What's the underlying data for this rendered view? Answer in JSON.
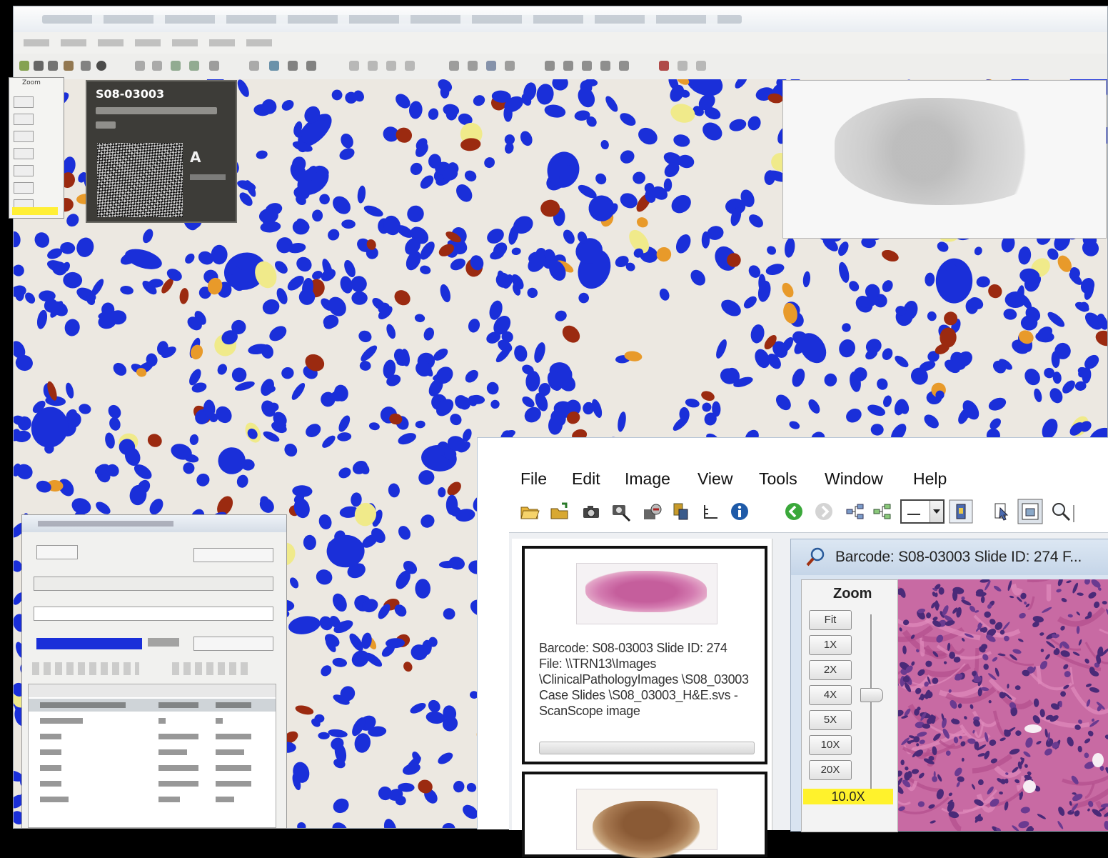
{
  "background_window": {
    "label_barcode": "S08-03003",
    "label_letter": "A"
  },
  "menu": {
    "items": [
      "File",
      "Edit",
      "Image",
      "View",
      "Tools",
      "Window",
      "Help"
    ]
  },
  "toolbar": {
    "icons": [
      "open-folder-icon",
      "open-folder-arrow-icon",
      "camera-icon",
      "magnifier-camera-icon",
      "export-icon",
      "server-icon",
      "measure-icon",
      "info-icon",
      "back-icon",
      "forward-icon",
      "tree-icon",
      "tree-alt-icon",
      "layout-select-icon",
      "window-icon",
      "pointer-icon",
      "thumbnail-icon",
      "search-icon"
    ]
  },
  "slides": [
    {
      "info": "Barcode: S08-03003   Slide ID: 274  File: \\\\TRN13\\Images \\ClinicalPathologyImages \\S08_03003 Case Slides \\S08_03003_H&E.svs - ScanScope image",
      "stain_color": "#c55e9c"
    },
    {
      "stain_color": "#8a5a35"
    }
  ],
  "viewer": {
    "title": "Barcode: S08-03003   Slide ID: 274  F...",
    "zoom": {
      "title": "Zoom",
      "buttons": [
        "Fit",
        "1X",
        "2X",
        "4X",
        "5X",
        "10X",
        "20X"
      ],
      "value": "10.0X",
      "level_fraction": 0.55
    }
  },
  "colors": {
    "nuclei_blue": "#1a2fd9",
    "positive_brown": "#9b2a10",
    "weak_yellow": "#f0ea8a",
    "moderate_orange": "#e89a2a",
    "zoom_highlight": "#fff22c"
  }
}
